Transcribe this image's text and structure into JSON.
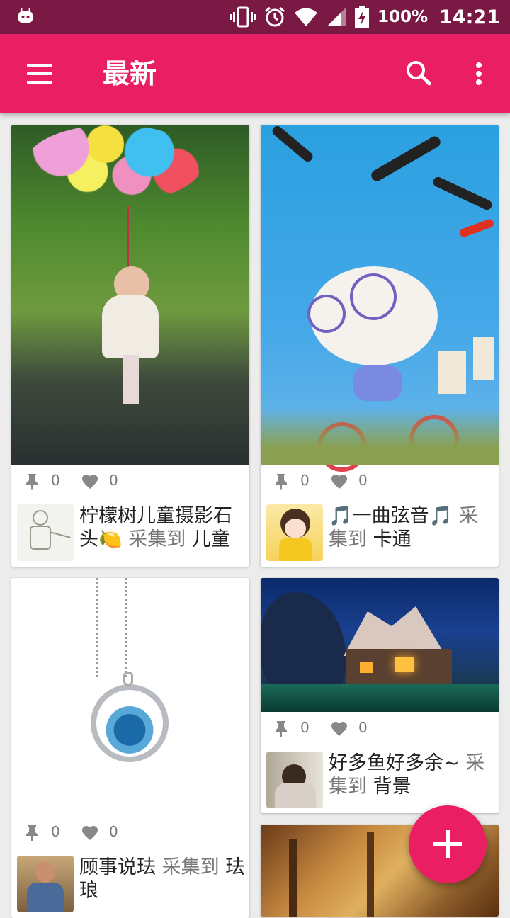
{
  "status_bar": {
    "battery_percent": "100%",
    "time": "14:21"
  },
  "app_bar": {
    "title": "最新"
  },
  "cards": [
    {
      "pins": "0",
      "likes": "0",
      "title": "柠檬树儿童摄影石头",
      "title_suffix": "🍋",
      "collect_label": "采集到",
      "board": "儿童"
    },
    {
      "pins": "0",
      "likes": "0",
      "title": "🎵一曲弦音🎵",
      "collect_label": "采集到",
      "board": "卡通"
    },
    {
      "pins": "0",
      "likes": "0",
      "title": "顾事说珐",
      "collect_label": "采集到",
      "board": "珐琅"
    },
    {
      "pins": "0",
      "likes": "0",
      "title": "好多鱼好多余~",
      "collect_label": "采集到",
      "board": "背景"
    }
  ],
  "colors": {
    "primary": "#e91e63",
    "status_bar": "#7a1a44",
    "background": "#ececec"
  },
  "icons": [
    "android-icon",
    "vibrate-icon",
    "alarm-icon",
    "wifi-icon",
    "signal-icon",
    "battery-charging-icon",
    "menu-icon",
    "search-icon",
    "more-vert-icon",
    "pin-icon",
    "heart-icon",
    "add-icon"
  ]
}
